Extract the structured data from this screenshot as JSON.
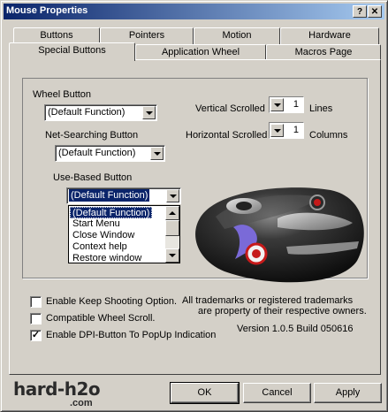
{
  "window": {
    "title": "Mouse Properties",
    "help_glyph": "?",
    "close_glyph": "✕"
  },
  "tabs_row1": [
    "Buttons",
    "Pointers",
    "Motion",
    "Hardware"
  ],
  "tabs_row2": [
    "Special Buttons",
    "Application Wheel",
    "Macros Page"
  ],
  "active_tab": "Special Buttons",
  "wheel_button": {
    "label": "Wheel Button",
    "value": "(Default Function)"
  },
  "net_searching_button": {
    "label": "Net-Searching Button",
    "value": "(Default Function)"
  },
  "use_based_button": {
    "label": "Use-Based Button",
    "value": "(Default Function)",
    "options": [
      "(Default Function)",
      "Start Menu",
      "Close Window",
      "Context help",
      "Restore window"
    ],
    "selected_index": 0
  },
  "vertical_scrolled": {
    "label": "Vertical Scrolled",
    "value": "1",
    "unit": "Lines"
  },
  "horizontal_scrolled": {
    "label": "Horizontal Scrolled",
    "value": "1",
    "unit": "Columns"
  },
  "checkboxes": [
    {
      "label": "Enable Keep Shooting Option.",
      "checked": false
    },
    {
      "label": "Compatible Wheel Scroll.",
      "checked": false
    },
    {
      "label": "Enable DPI-Button To PopUp Indication",
      "checked": true
    }
  ],
  "trademark_line1": "All trademarks or registered trademarks",
  "trademark_line2": "are property of their respective owners.",
  "version": "Version 1.0.5 Build 050616",
  "buttons": {
    "ok": "OK",
    "cancel": "Cancel",
    "apply": "Apply"
  },
  "brand": {
    "main": "hard-h2o",
    "sub": ".com"
  },
  "check_glyph": "✓",
  "colors": {
    "title_start": "#0a246a",
    "title_end": "#a6caf0",
    "face": "#d4d0c8",
    "highlight": "#0a246a"
  }
}
